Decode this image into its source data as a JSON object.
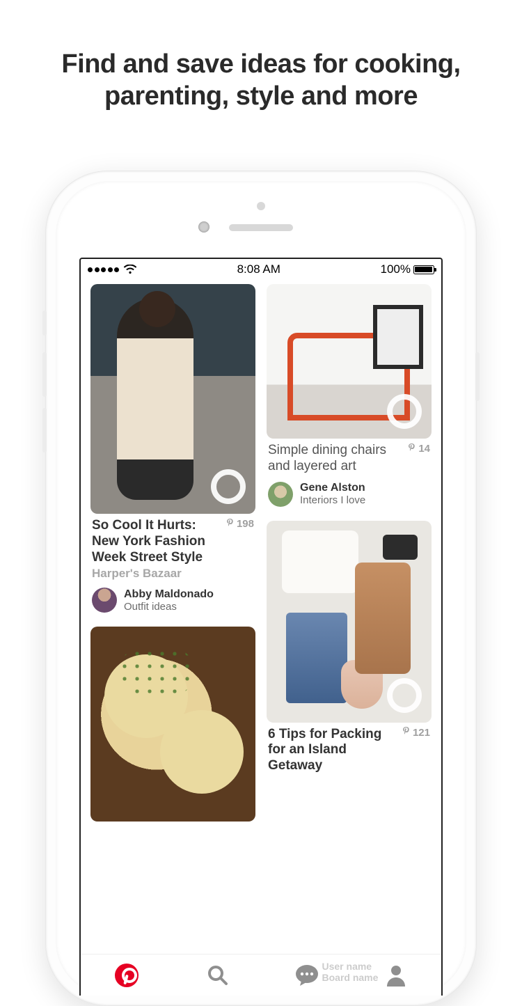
{
  "headline_line1": "Find and save ideas for cooking,",
  "headline_line2": "parenting, style and more",
  "statusbar": {
    "time": "8:08 AM",
    "battery_pct": "100%"
  },
  "pins": [
    {
      "title": "So Cool It Hurts: New York Fashion Week Street Style",
      "source": "Harper's Bazaar",
      "count": "198",
      "user_name": "Abby Maldonado",
      "user_board": "Outfit ideas",
      "avatar_bg": "#6b4a6e"
    },
    {
      "title": "Simple dining chairs and layered art",
      "count": "14",
      "user_name": "Gene Alston",
      "user_board": "Interiors I love",
      "avatar_bg": "#7fa06a"
    },
    {
      "title": "6 Tips for Packing for an Island Getaway",
      "count": "121"
    }
  ],
  "tabbar_ghost": {
    "user_name": "User name",
    "board_name": "Board name"
  }
}
